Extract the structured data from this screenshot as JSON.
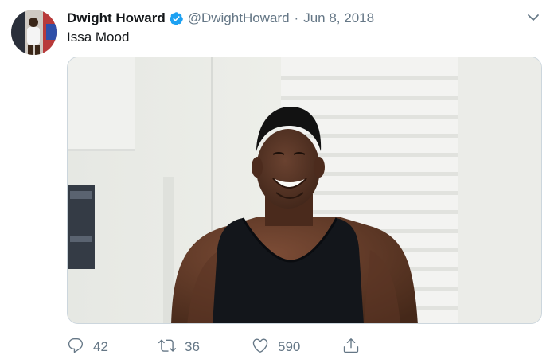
{
  "tweet": {
    "author": {
      "name": "Dwight Howard",
      "handle": "@DwightHoward",
      "verified": true
    },
    "separator": "·",
    "date": "Jun 8, 2018",
    "text": "Issa Mood",
    "stats": {
      "replies": "42",
      "retweets": "36",
      "likes": "590"
    }
  },
  "icons": {
    "verified": "verified-badge-icon",
    "caret": "chevron-down-icon",
    "reply": "reply-icon",
    "retweet": "retweet-icon",
    "like": "heart-icon",
    "share": "share-icon"
  },
  "colors": {
    "text": "#14171a",
    "secondary": "#657786",
    "verified": "#1da1f2"
  }
}
